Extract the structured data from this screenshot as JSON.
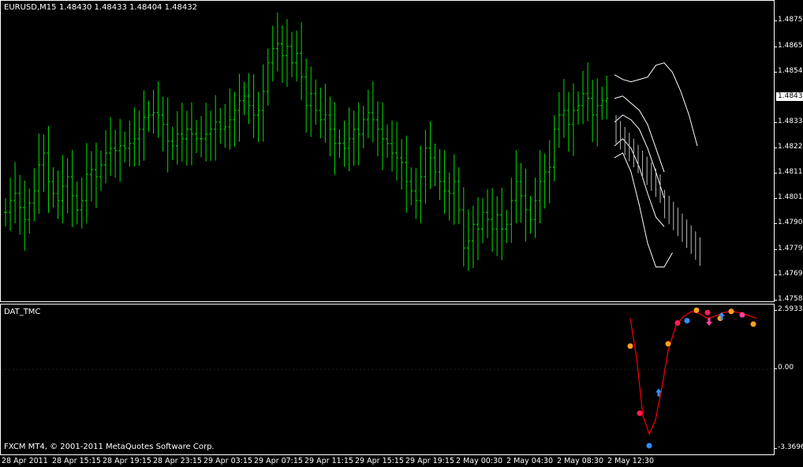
{
  "header": {
    "symbol_tf": "EURUSD,M15",
    "ohlc": "1.48430 1.48433 1.48404 1.48432"
  },
  "indicator": {
    "name": "DAT_TMC",
    "copyright": "FXCM MT4, © 2001-2011 MetaQuotes Software Corp."
  },
  "colors": {
    "bars": "#00e000",
    "projection": "#ffffff",
    "curve": "#ff0000",
    "marker_orange": "#ffa020",
    "marker_red": "#ff2050",
    "marker_blue": "#3090ff",
    "marker_magenta": "#ff40a0"
  },
  "price_scale": {
    "labels": [
      "1.48755",
      "1.48650",
      "1.48540",
      "1.48330",
      "1.48220",
      "1.48115",
      "1.48010",
      "1.47900",
      "1.47795",
      "1.47690",
      "1.47585"
    ],
    "current": "1.48432"
  },
  "indicator_scale": {
    "labels": [
      "2.5933",
      "0.00",
      "-3.3696"
    ]
  },
  "time_axis": {
    "labels": [
      "28 Apr 2011",
      "28 Apr 15:15",
      "28 Apr 19:15",
      "28 Apr 23:15",
      "29 Apr 03:15",
      "29 Apr 07:15",
      "29 Apr 11:15",
      "29 Apr 15:15",
      "29 Apr 19:15",
      "2 May 00:30",
      "2 May 04:30",
      "2 May 08:30",
      "2 May 12:30"
    ]
  },
  "chart_data": {
    "type": "bar",
    "x_unit": "bar index (M15)",
    "price_range": [
      1.47585,
      1.48755
    ],
    "series": [
      {
        "values": [
          1.4795,
          1.48,
          1.4803,
          1.4797,
          1.4792,
          1.4799,
          1.4804,
          1.4815,
          1.482,
          1.4808,
          1.4803,
          1.48,
          1.4806,
          1.481,
          1.4802,
          1.4796,
          1.48,
          1.4811,
          1.4813,
          1.481,
          1.4815,
          1.482,
          1.4822,
          1.4821,
          1.4823,
          1.4822,
          1.4824,
          1.4826,
          1.483,
          1.4835,
          1.4836,
          1.4837,
          1.4836,
          1.4832,
          1.4825,
          1.4823,
          1.4828,
          1.4826,
          1.483,
          1.4828,
          1.4826,
          1.4826,
          1.4828,
          1.483,
          1.4833,
          1.483,
          1.4831,
          1.4834,
          1.4838,
          1.4842,
          1.4844,
          1.484,
          1.4836,
          1.4838,
          1.4846,
          1.4858,
          1.4864,
          1.4866,
          1.4861,
          1.4865,
          1.4858,
          1.4862,
          1.4852,
          1.484,
          1.4845,
          1.4838,
          1.4834,
          1.4836,
          1.483,
          1.4824,
          1.4824,
          1.4822,
          1.4826,
          1.483,
          1.4828,
          1.4834,
          1.4837,
          1.4834,
          1.483,
          1.4826,
          1.4824,
          1.482,
          1.4818,
          1.4816,
          1.4808,
          1.4804,
          1.48,
          1.481,
          1.4822,
          1.4818,
          1.4812,
          1.4808,
          1.4804,
          1.4803,
          1.4808,
          1.4796,
          1.478,
          1.4783,
          1.479,
          1.4788,
          1.4795,
          1.4792,
          1.4788,
          1.4794,
          1.4788,
          1.479,
          1.48,
          1.4808,
          1.4802,
          1.4796,
          1.4792,
          1.48,
          1.4808,
          1.4812,
          1.4814,
          1.483,
          1.4836,
          1.4838,
          1.4832,
          1.4838,
          1.484,
          1.4845,
          1.4843,
          1.4836,
          1.484,
          1.4842,
          1.4843
        ]
      }
    ],
    "projection": {
      "band_top": [
        1.4853,
        1.4851,
        1.485,
        1.4851,
        1.4852,
        1.4857,
        1.4858,
        1.4854,
        1.4846,
        1.4836,
        1.4823
      ],
      "band_upper": [
        1.4843,
        1.4844,
        1.4841,
        1.4838,
        1.4832,
        1.4822,
        1.4812
      ],
      "band_mid": [
        1.4833,
        1.4836,
        1.4834,
        1.483,
        1.4822,
        1.4812,
        1.4801
      ],
      "band_lower": [
        1.4823,
        1.4826,
        1.4822,
        1.4814,
        1.4803,
        1.4793,
        1.4789
      ],
      "band_bottom": [
        1.4818,
        1.482,
        1.4812,
        1.4798,
        1.4782,
        1.4772,
        1.4772,
        1.4778
      ]
    },
    "oscillator": {
      "curve_points": [
        2.2,
        0.5,
        -2.0,
        -2.8,
        -2.2,
        -0.8,
        0.8,
        1.9,
        2.3,
        2.5,
        2.4,
        2.2,
        2.3,
        2.45,
        2.5,
        2.45,
        2.35,
        2.2
      ],
      "ylim": [
        -3.3696,
        2.5933
      ]
    }
  }
}
